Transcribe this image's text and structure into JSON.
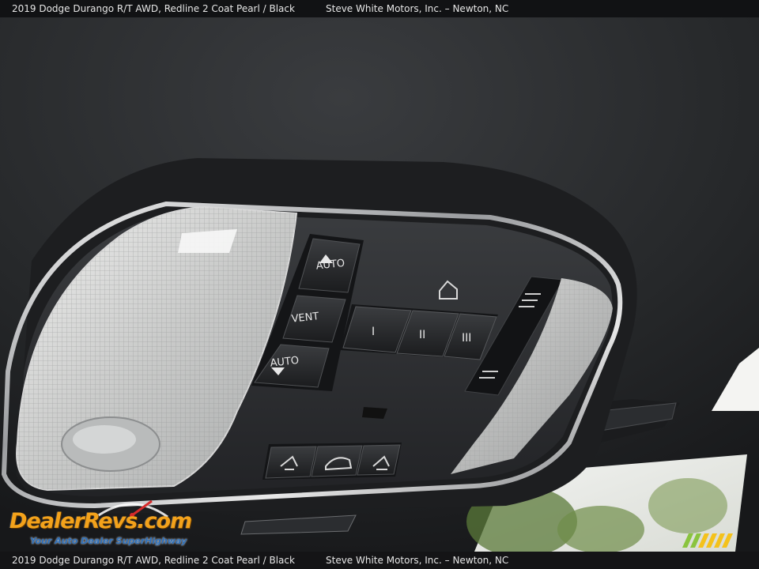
{
  "caption": {
    "vehicle": "2019 Dodge Durango R/T AWD,  Redline 2 Coat Pearl / Black",
    "dealer": "Steve White Motors, Inc. – Newton, NC"
  },
  "console": {
    "sunroof_buttons": [
      "AUTO",
      "VENT",
      "AUTO"
    ],
    "garage_buttons": [
      "I",
      "II",
      "III"
    ]
  },
  "watermark": {
    "brand": "DealerRevs.com",
    "tagline": "Your Auto Dealer SuperHighway"
  },
  "colors": {
    "headliner": "#2a2c2e",
    "console_plastic": "#2e3033",
    "brand_orange": "#f3a21b",
    "brand_blue": "#2e6fb8",
    "stripe_green": "#8ac43f",
    "stripe_yellow": "#f4c21b"
  }
}
